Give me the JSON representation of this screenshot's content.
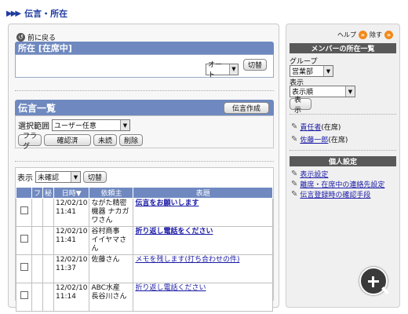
{
  "page_title": "伝言・所在",
  "back": {
    "label": "前に戻る"
  },
  "status_section": {
    "title": "所在 [在席中]",
    "select_value": "オート",
    "change_button": "切替"
  },
  "messages_section": {
    "title": "伝言一覧",
    "create_button": "伝言作成",
    "scope_label": "選択範囲",
    "scope_value": "ユーザー任意",
    "buttons": [
      "フラグ",
      "確認済",
      "未読",
      "削除"
    ],
    "display_label": "表示",
    "display_value": "未確認",
    "display_change_button": "切替",
    "columns": [
      "フ",
      "秘",
      "日時▼",
      "依頼主",
      "表題"
    ],
    "rows": [
      {
        "date": "12/02/10",
        "time": "11:41",
        "sender": [
          "ながた精密",
          "機器 ナカガ",
          "ワさん"
        ],
        "subject": "伝言をお願いします",
        "bold": true
      },
      {
        "date": "12/02/10",
        "time": "11:41",
        "sender": [
          "谷村商事",
          "イイヤマさ",
          "ん"
        ],
        "subject": "折り返し電話をください",
        "bold": true
      },
      {
        "date": "12/02/10",
        "time": "11:37",
        "sender": [
          "佐藤さん"
        ],
        "subject": "メモを残します(打ち合わせの件)",
        "bold": false
      },
      {
        "date": "12/02/10",
        "time": "11:14",
        "sender": [
          "ABC水産",
          "長谷川さん"
        ],
        "subject": "折り返し電話ください",
        "bold": false
      }
    ]
  },
  "sidebar": {
    "help": "ヘルプ",
    "close": "除す",
    "member_title": "メンバーの所在一覧",
    "group_label": "グループ",
    "group_value": "営業部",
    "display_label": "表示",
    "display_value": "表示順",
    "display_button": "表示",
    "members": [
      {
        "name": "責任者",
        "status": "(在席)"
      },
      {
        "name": "佐藤一郎",
        "status": "(在席)"
      }
    ],
    "personal_title": "個人設定",
    "links": [
      "表示設定",
      "離席・在席中の連絡先設定",
      "伝言登録時の確認手段"
    ]
  }
}
